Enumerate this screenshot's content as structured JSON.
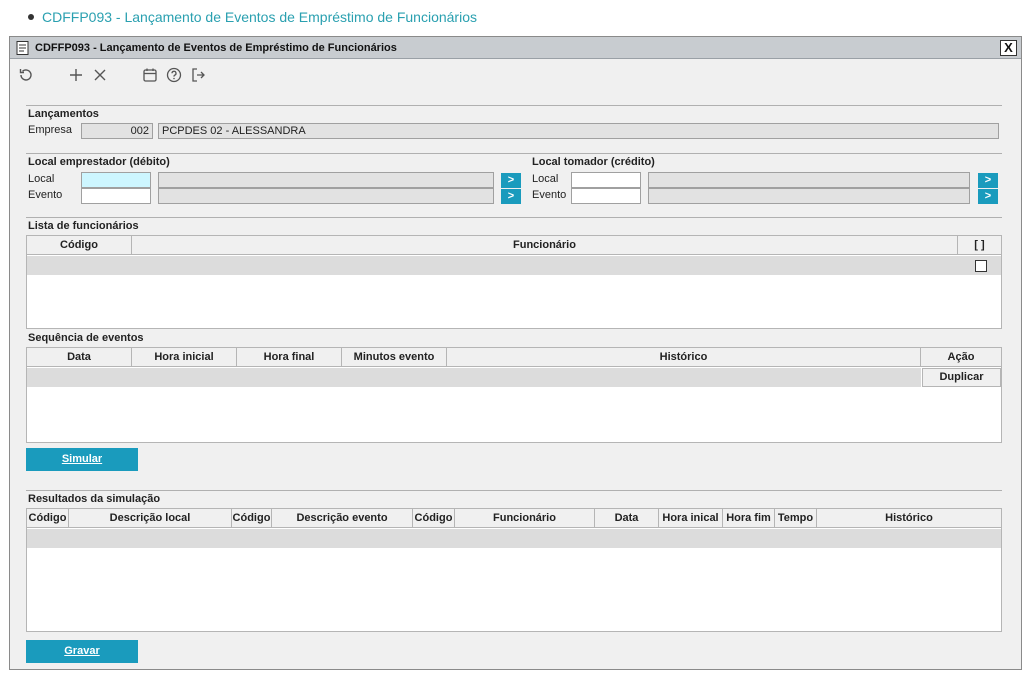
{
  "breadcrumb": {
    "text": "CDFFP093 - Lançamento de Eventos de Empréstimo de Funcionários"
  },
  "window": {
    "title": "CDFFP093 - Lançamento de Eventos de Empréstimo de Funcionários",
    "close_label": "X"
  },
  "toolbar": {
    "icons": [
      "refresh-icon",
      "add-icon",
      "cancel-icon",
      "calendar-icon",
      "help-icon",
      "exit-icon"
    ]
  },
  "lancamentos": {
    "section": "Lançamentos",
    "empresa_label": "Empresa",
    "empresa_code": "002",
    "empresa_name": "PCPDES 02 - ALESSANDRA"
  },
  "emprestador": {
    "section": "Local emprestador (débito)",
    "local_label": "Local",
    "evento_label": "Evento",
    "local_value": "",
    "evento_value": "",
    "go_label": ">"
  },
  "tomador": {
    "section": "Local tomador (crédito)",
    "local_label": "Local",
    "evento_label": "Evento",
    "local_value": "",
    "evento_value": "",
    "go_label": ">"
  },
  "funcionarios": {
    "section": "Lista de funcionários",
    "columns": [
      "Código",
      "Funcionário",
      "[ ]"
    ]
  },
  "sequencia": {
    "section": "Sequência de eventos",
    "columns": [
      "Data",
      "Hora inicial",
      "Hora final",
      "Minutos evento",
      "Histórico",
      "Ação"
    ],
    "duplicate_label": "Duplicar"
  },
  "simular_button": "Simular",
  "resultados": {
    "section": "Resultados da simulação",
    "columns": [
      "Código",
      "Descrição local",
      "Código",
      "Descrição evento",
      "Código",
      "Funcionário",
      "Data",
      "Hora inical",
      "Hora fim",
      "Tempo",
      "Histórico"
    ]
  },
  "gravar_button": "Gravar",
  "colors": {
    "accent": "#1a9bbd",
    "link": "#2aa0b0",
    "focus": "#cdf6ff"
  }
}
